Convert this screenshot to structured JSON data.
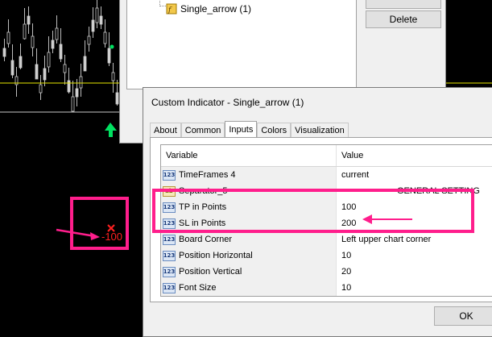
{
  "back_window": {
    "tree_item": "Single_arrow (1)",
    "delete_button": "Delete"
  },
  "dialog": {
    "title": "Custom Indicator - Single_arrow (1)",
    "tabs": [
      "About",
      "Common",
      "Inputs",
      "Colors",
      "Visualization"
    ],
    "active_tab": "Inputs",
    "headers": {
      "variable": "Variable",
      "value": "Value"
    },
    "rows": [
      {
        "icon": "123",
        "variable": "TimeFrames 4",
        "value": "current"
      },
      {
        "icon": "ab",
        "variable": "Separator_5",
        "value": "------------------ GENERAL SETTING"
      },
      {
        "icon": "123",
        "variable": "TP in Points",
        "value": "100"
      },
      {
        "icon": "123",
        "variable": "SL in Points",
        "value": "200"
      },
      {
        "icon": "123",
        "variable": "Board Corner",
        "value": "Left upper chart corner"
      },
      {
        "icon": "123",
        "variable": "Position Horizontal",
        "value": "10"
      },
      {
        "icon": "123",
        "variable": "Position Vertical",
        "value": "20"
      },
      {
        "icon": "123",
        "variable": "Font Size",
        "value": "10"
      }
    ],
    "ok_button": "OK"
  },
  "chart": {
    "price_label": "-100",
    "colors": {
      "accent": "#ff1e8c",
      "arrow": "#00e060",
      "level_line": "#e8e800",
      "label": "#ff2020"
    }
  }
}
